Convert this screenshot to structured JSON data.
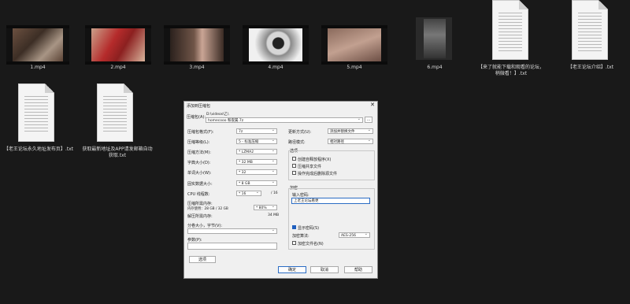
{
  "files": [
    {
      "name": "1.mp4"
    },
    {
      "name": "2.mp4"
    },
    {
      "name": "3.mp4"
    },
    {
      "name": "4.mp4"
    },
    {
      "name": "5.mp4"
    },
    {
      "name": "6.mp4"
    },
    {
      "name": "【来了就能下载和观看的论坛，稍微看！】.txt"
    },
    {
      "name": "【老王论坛介绍】.txt"
    },
    {
      "name": "【老王论坛永久地址发布页】.txt"
    },
    {
      "name": "获取最新地址及APP请发邮箱自动获取.txt"
    }
  ],
  "dialog": {
    "title": "添加到压缩包",
    "close": "✕",
    "archive_label": "压缩包(A):",
    "archive_path": "D:\\videos\\乙\\",
    "archive_name": "homecooo 和夜属.7z",
    "browse": "...",
    "format_label": "压缩包格式(F):",
    "format_value": "7z",
    "level_label": "压缩等级(L):",
    "level_value": "5 - 标准压缩",
    "method_label": "压缩方法(M):",
    "method_value": "* LZMA2",
    "dict_label": "字典大小(D):",
    "dict_value": "* 32 MB",
    "word_label": "单词大小(W):",
    "word_value": "* 32",
    "solid_label": "固实数据大小:",
    "solid_value": "* 8 GB",
    "cpu_label": "CPU 线程数:",
    "cpu_value": "* 16",
    "cpu_total": "/ 16",
    "mem_label": "压缩所需内存:",
    "mem_sub": "内存使用：28 GB / 32 GB",
    "mem_pct": "* 80%",
    "decomp_label": "解压所需内存:",
    "decomp_value": "34 MB",
    "split_label": "分卷大小，字节(V):",
    "params_label": "参数(P):",
    "options_btn": "选项",
    "update_label": "更新方式(U):",
    "update_value": "添加并替换文件",
    "path_label": "路径模式:",
    "path_value": "相对路径",
    "options_group": "选项",
    "opt1": "创建自释放程序(X)",
    "opt2": "压缩共享文件",
    "opt3": "操作完成后删除源文件",
    "enc_group": "加密",
    "pwd_label": "输入密码:",
    "pwd_value": "上老王论坛看更",
    "show_pwd": "显示密码(S)",
    "enc_method_label": "加密算法:",
    "enc_method_value": "AES-256",
    "enc_names": "加密文件名(N)",
    "ok": "确定",
    "cancel": "取消",
    "help": "帮助"
  }
}
